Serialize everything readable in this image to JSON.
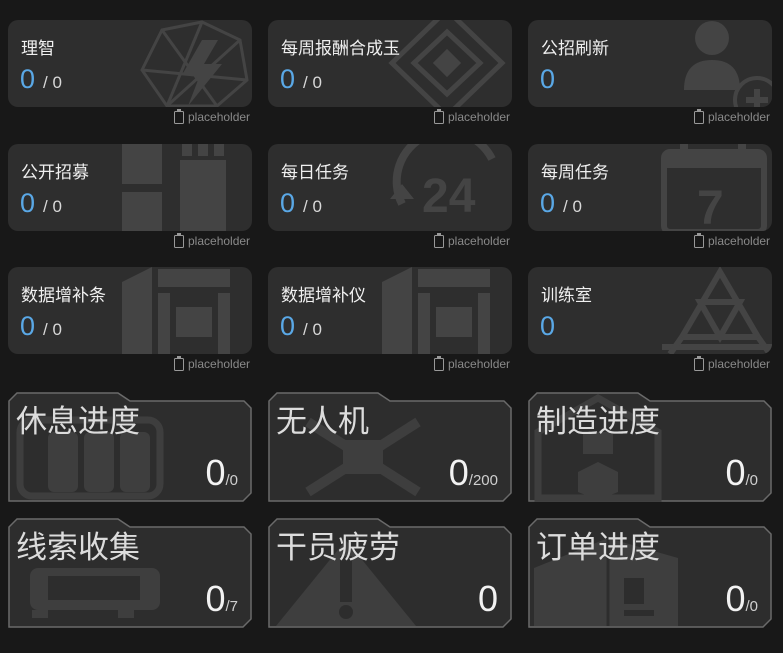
{
  "cards": [
    {
      "title": "理智",
      "value": "0",
      "max": "/ 0",
      "note": "placeholder"
    },
    {
      "title": "每周报酬合成玉",
      "value": "0",
      "max": "/ 0",
      "note": "placeholder"
    },
    {
      "title": "公招刷新",
      "value": "0",
      "max": "",
      "note": "placeholder"
    },
    {
      "title": "公开招募",
      "value": "0",
      "max": "/ 0",
      "note": "placeholder"
    },
    {
      "title": "每日任务",
      "value": "0",
      "max": "/ 0",
      "note": "placeholder"
    },
    {
      "title": "每周任务",
      "value": "0",
      "max": "/ 0",
      "note": "placeholder"
    },
    {
      "title": "数据增补条",
      "value": "0",
      "max": "/ 0",
      "note": "placeholder"
    },
    {
      "title": "数据增补仪",
      "value": "0",
      "max": "/ 0",
      "note": "placeholder"
    },
    {
      "title": "训练室",
      "value": "0",
      "max": "",
      "note": "placeholder"
    }
  ],
  "panels": [
    {
      "title": "休息进度",
      "value": "0",
      "max": "/0"
    },
    {
      "title": "无人机",
      "value": "0",
      "max": "/200"
    },
    {
      "title": "制造进度",
      "value": "0",
      "max": "/0"
    },
    {
      "title": "线索收集",
      "value": "0",
      "max": "/7"
    },
    {
      "title": "干员疲劳",
      "value": "0",
      "max": ""
    },
    {
      "title": "订单进度",
      "value": "0",
      "max": "/0"
    }
  ],
  "icons": {
    "cards": [
      "sanity-icon",
      "orundum-icon",
      "recruit-refresh-icon",
      "recruit-icon",
      "daily-24-icon",
      "weekly-calendar-icon",
      "data-supplement-stick-icon",
      "data-supplement-instrument-icon",
      "training-room-icon"
    ],
    "panels": [
      "dormitory-icon",
      "drone-icon",
      "factory-icon",
      "reception-sofa-icon",
      "fatigue-warning-icon",
      "trading-box-icon"
    ]
  }
}
